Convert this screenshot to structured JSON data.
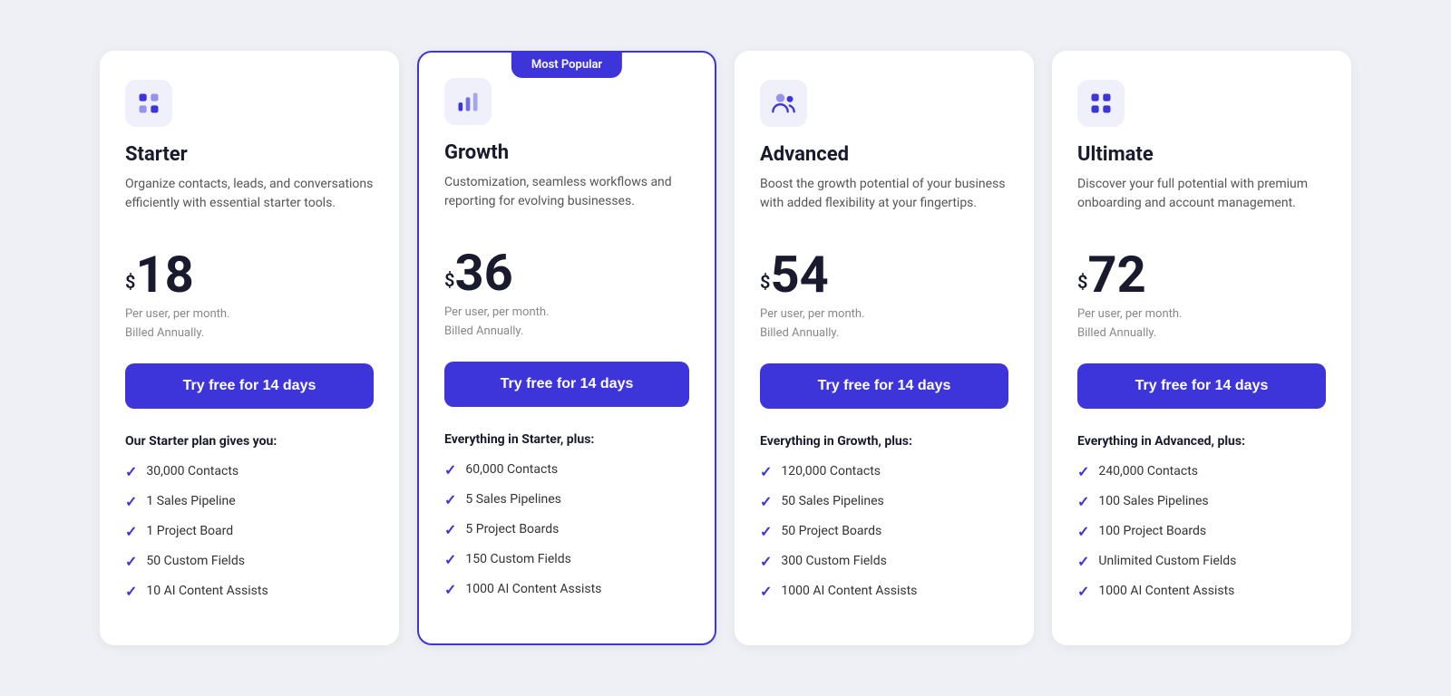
{
  "plans": [
    {
      "id": "starter",
      "name": "Starter",
      "description": "Organize contacts, leads, and conversations efficiently with essential starter tools.",
      "price": "18",
      "price_meta_line1": "Per user, per month.",
      "price_meta_line2": "Billed Annually.",
      "cta": "Try free for 14 days",
      "features_heading": "Our Starter plan gives you:",
      "featured": false,
      "icon_type": "apps",
      "features": [
        "30,000 Contacts",
        "1 Sales Pipeline",
        "1 Project Board",
        "50 Custom Fields",
        "10 AI Content Assists"
      ]
    },
    {
      "id": "growth",
      "name": "Growth",
      "description": "Customization, seamless workflows and reporting for evolving businesses.",
      "price": "36",
      "price_meta_line1": "Per user, per month.",
      "price_meta_line2": "Billed Annually.",
      "cta": "Try free for 14 days",
      "features_heading": "Everything in Starter, plus:",
      "featured": true,
      "badge": "Most Popular",
      "icon_type": "chart",
      "features": [
        "60,000 Contacts",
        "5 Sales Pipelines",
        "5 Project Boards",
        "150 Custom Fields",
        "1000 AI Content Assists"
      ]
    },
    {
      "id": "advanced",
      "name": "Advanced",
      "description": "Boost the growth potential of your business with added flexibility at your fingertips.",
      "price": "54",
      "price_meta_line1": "Per user, per month.",
      "price_meta_line2": "Billed Annually.",
      "cta": "Try free for 14 days",
      "features_heading": "Everything in Growth, plus:",
      "featured": false,
      "icon_type": "users",
      "features": [
        "120,000 Contacts",
        "50 Sales Pipelines",
        "50 Project Boards",
        "300 Custom Fields",
        "1000 AI Content Assists"
      ]
    },
    {
      "id": "ultimate",
      "name": "Ultimate",
      "description": "Discover your full potential with premium onboarding and account management.",
      "price": "72",
      "price_meta_line1": "Per user, per month.",
      "price_meta_line2": "Billed Annually.",
      "cta": "Try free for 14 days",
      "features_heading": "Everything in Advanced, plus:",
      "featured": false,
      "icon_type": "grid",
      "features": [
        "240,000 Contacts",
        "100 Sales Pipelines",
        "100 Project Boards",
        "Unlimited Custom Fields",
        "1000 AI Content Assists"
      ]
    }
  ],
  "icons": {
    "apps": "apps",
    "chart": "chart",
    "users": "users",
    "grid": "grid"
  }
}
